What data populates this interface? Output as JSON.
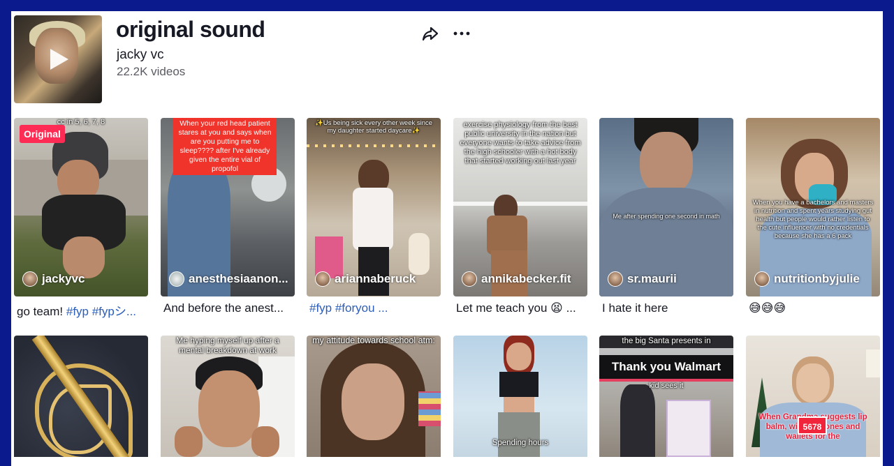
{
  "sound": {
    "title": "original sound",
    "author": "jacky vc",
    "video_count": "22.2K videos"
  },
  "icons": {
    "share": "share-icon",
    "more": "more-icon",
    "play": "play-icon"
  },
  "videos": [
    {
      "badge": "Original",
      "overlay": "cc in 5, 6, 7, 8",
      "creator": "jackyvc",
      "desc_parts": [
        {
          "t": "go team! ",
          "tag": false
        },
        {
          "t": "#fyp #fypシ...",
          "tag": true
        }
      ]
    },
    {
      "overlay": "When your red head patient stares at you and says when are you putting me to sleep???? after I've already given the entire vial of propofol",
      "creator": "anesthesiaanon...",
      "desc_parts": [
        {
          "t": "And before the anest...",
          "tag": false
        }
      ]
    },
    {
      "overlay": "✨Us being sick every other week since my daughter started daycare✨",
      "creator": "ariannaberuck",
      "desc_parts": [
        {
          "t": "#fyp #foryou ...",
          "tag": true
        }
      ]
    },
    {
      "overlay": "exercise physiology from the best public university in the nation but everyone wants to take advice from the high schooler with a hot body that started working out last year",
      "creator": "annikabecker.fit",
      "desc_parts": [
        {
          "t": "Let me teach you 😫 ...",
          "tag": false
        }
      ]
    },
    {
      "overlay": "Me after spending one second in math",
      "creator": "sr.maurii",
      "desc_parts": [
        {
          "t": "I hate it here",
          "tag": false
        }
      ]
    },
    {
      "overlay": "When you have a bachelors and masters in nutrition and spent years studying gut health but people would rather listen to the cute influencer with no credentials because she has a 6 pack",
      "creator": "nutritionbyjulie",
      "desc_parts": [
        {
          "t": "😅😅😅",
          "tag": false
        }
      ]
    },
    {
      "overlay": ""
    },
    {
      "overlay": "Me hyping myself up after a mental breakdown at work"
    },
    {
      "overlay": "my attitude towards school atm:"
    },
    {
      "overlay": "Spending hours"
    },
    {
      "overlay": "the big Santa presents in",
      "banner": "Thank you Walmart",
      "overlay2": "kid sees it"
    },
    {
      "overlay": "When Grandma suggests lip balm, wiskey stones and wallets for the",
      "sticker": "5678"
    }
  ],
  "colors": {
    "accent": "#fe2c55",
    "hashtag": "#2b5db9",
    "frame": "#0b1a8c"
  }
}
